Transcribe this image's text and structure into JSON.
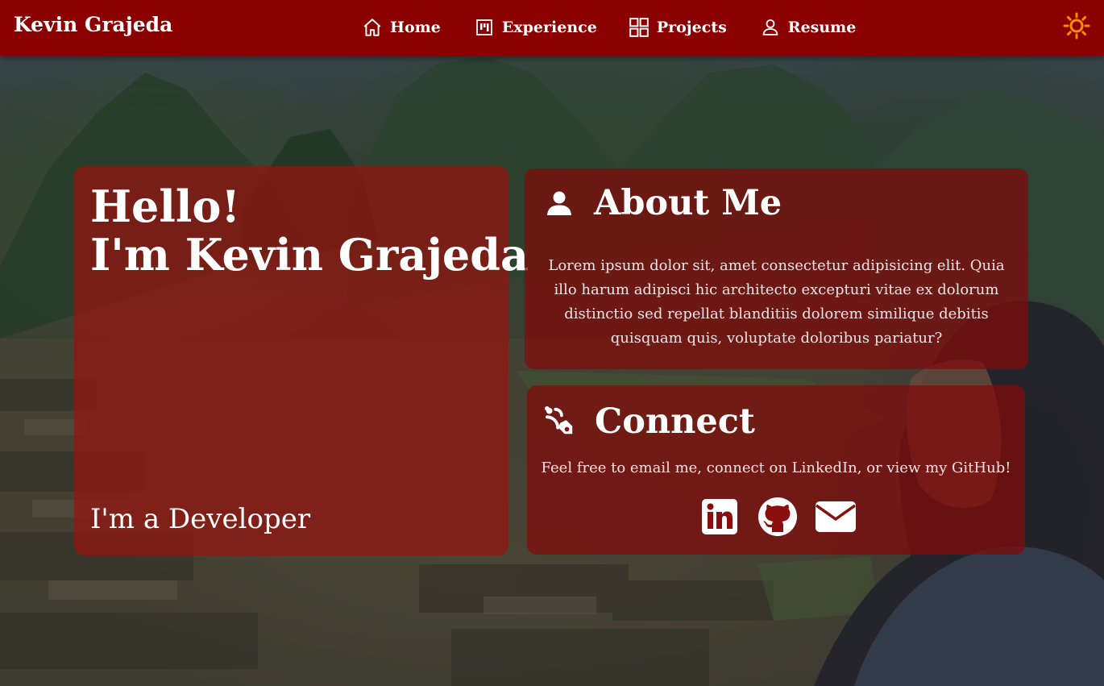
{
  "navbar": {
    "brand": "Kevin Grajeda",
    "links": [
      {
        "label": "Home",
        "icon": "home-icon"
      },
      {
        "label": "Experience",
        "icon": "kanban-icon"
      },
      {
        "label": "Projects",
        "icon": "grid-icon"
      },
      {
        "label": "Resume",
        "icon": "person-icon"
      }
    ],
    "theme_toggle_icon": "sun-icon",
    "bar_color": "#8b0000",
    "toggle_color": "#ff8c00"
  },
  "hero": {
    "greeting": "Hello!",
    "name_line": "I'm Kevin Grajeda",
    "role_line": "I'm a Developer"
  },
  "about": {
    "title": "About Me",
    "icon": "person-icon",
    "text": "Lorem ipsum dolor sit, amet consectetur adipisicing elit. Quia illo harum adipisci hic architecto excepturi vitae ex dolorum distinctio sed repellat blanditiis dolorem similique debitis quisquam quis, voluptate doloribus pariatur?"
  },
  "connect": {
    "title": "Connect",
    "icon": "connect-icon",
    "text": "Feel free to email me, connect on LinkedIn, or view my GitHub!",
    "links": [
      {
        "icon": "linkedin-icon"
      },
      {
        "icon": "github-icon"
      },
      {
        "icon": "email-icon"
      }
    ]
  }
}
